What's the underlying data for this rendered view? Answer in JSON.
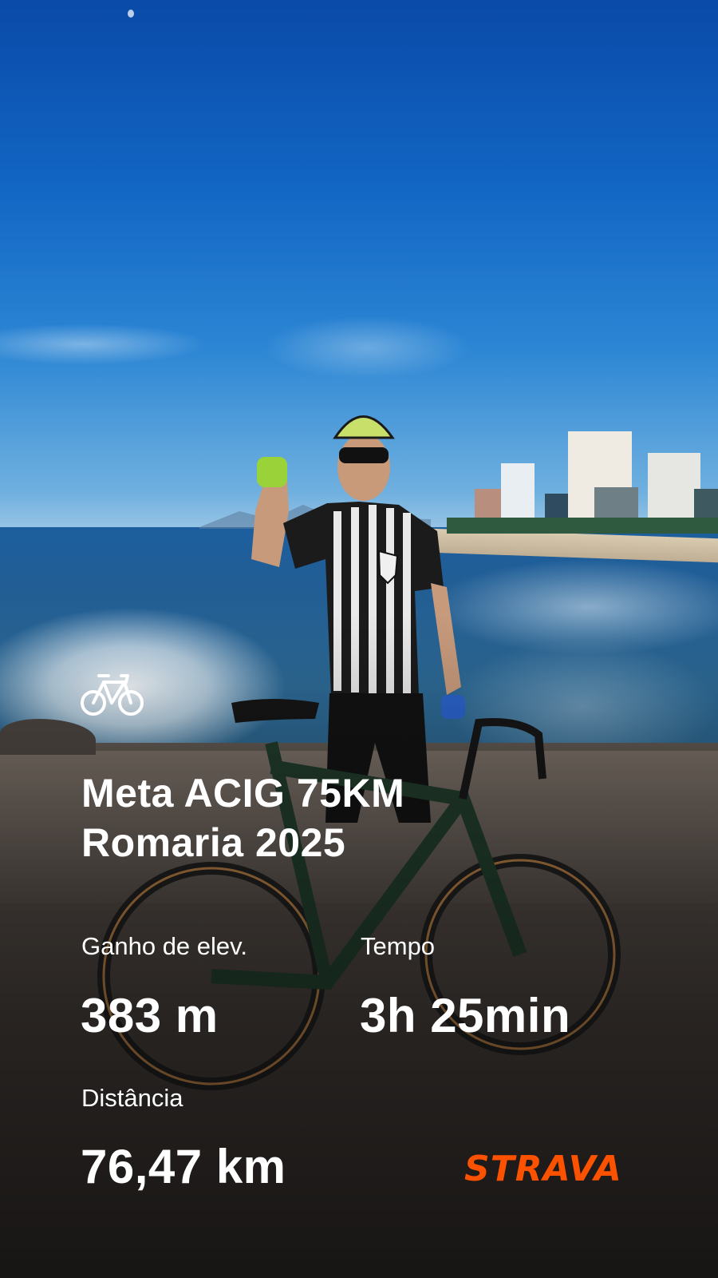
{
  "activity": {
    "sport_icon": "bike-icon",
    "title_line1": "Meta ACIG 75KM",
    "title_line2": "Romaria 2025"
  },
  "stats": {
    "elevation": {
      "label": "Ganho de elev.",
      "value": "383 m"
    },
    "time": {
      "label": "Tempo",
      "value": "3h 25min"
    },
    "distance": {
      "label": "Distância",
      "value": "76,47 km"
    }
  },
  "brand": {
    "name": "STRAVA",
    "color": "#fc5200"
  }
}
